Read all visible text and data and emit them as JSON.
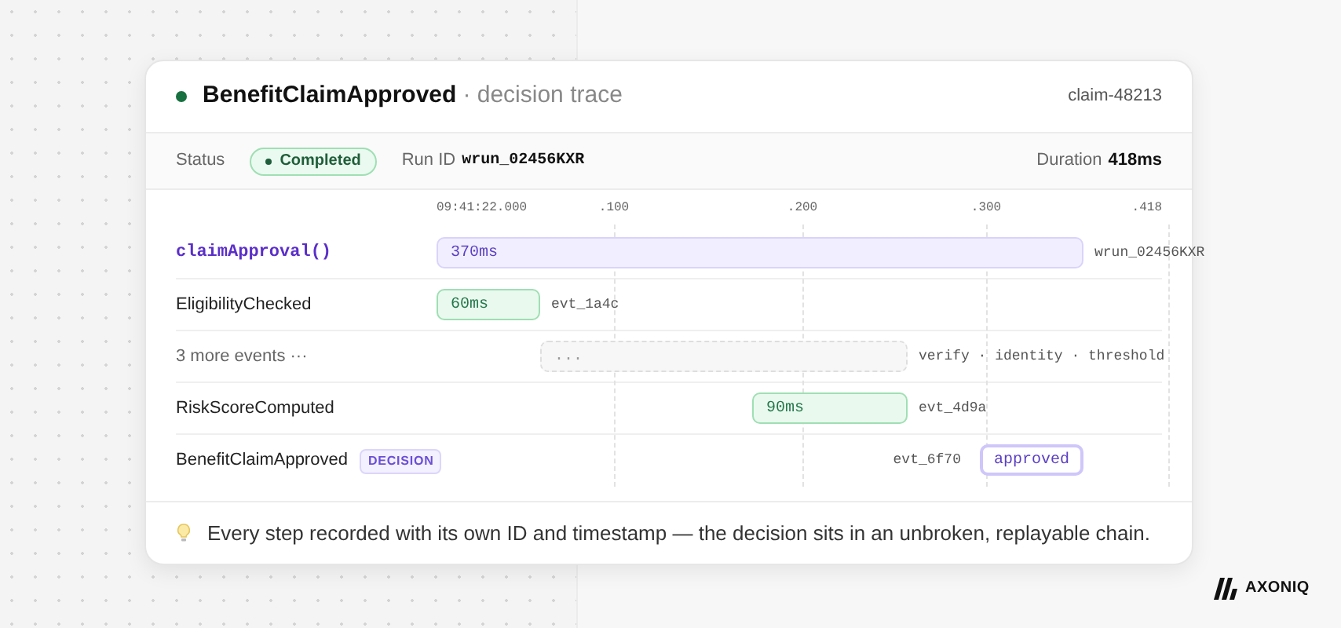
{
  "header": {
    "title": "BenefitClaimApproved",
    "subtitle": "· decision trace",
    "claim_id": "claim-48213"
  },
  "status_bar": {
    "status_label": "Status",
    "status": "Completed",
    "run_id_label": "Run ID",
    "run_id": "wrun_02456KXR",
    "duration_label": "Duration",
    "duration": "418ms"
  },
  "timeline": {
    "ticks": [
      "09:41:22.000",
      ".100",
      ".200",
      ".300",
      ".418"
    ],
    "rows": [
      {
        "kind": "call",
        "label": "claimApproval()",
        "bar": "370ms",
        "trailing": "wrun_02456KXR"
      },
      {
        "kind": "event",
        "label": "EligibilityChecked",
        "bar": "60ms",
        "trailing": "evt_1a4c"
      },
      {
        "kind": "more",
        "label": "3 more events ···",
        "bar": "...",
        "trailing": "verify · identity · threshold"
      },
      {
        "kind": "event",
        "label": "RiskScoreComputed",
        "bar": "90ms",
        "trailing": "evt_4d9a"
      },
      {
        "kind": "decision",
        "label": "BenefitClaimApproved",
        "badge": "DECISION",
        "bar": "approved",
        "trailing": "evt_6f70"
      }
    ]
  },
  "footer": {
    "note": "Every step recorded with its own ID and timestamp — the decision sits in an unbroken, replayable chain."
  },
  "logo": {
    "text": "AXONIQ"
  }
}
